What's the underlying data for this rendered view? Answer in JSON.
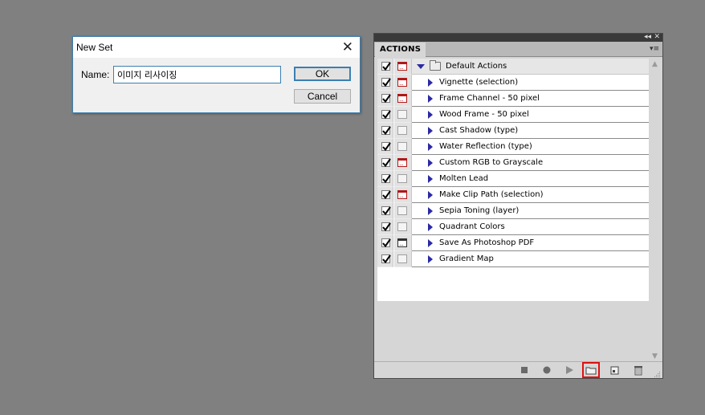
{
  "dialog": {
    "title": "New Set",
    "name_label": "Name:",
    "name_value": "이미지 리사이징",
    "ok_label": "OK",
    "cancel_label": "Cancel"
  },
  "panel": {
    "tab_label": "ACTIONS",
    "set": {
      "name": "Default Actions",
      "checked": true,
      "dialog": "red",
      "expanded": true
    },
    "actions": [
      {
        "name": "Vignette (selection)",
        "checked": true,
        "dialog": "red"
      },
      {
        "name": "Frame Channel - 50 pixel",
        "checked": true,
        "dialog": "red"
      },
      {
        "name": "Wood Frame - 50 pixel",
        "checked": true,
        "dialog": "none"
      },
      {
        "name": "Cast Shadow (type)",
        "checked": true,
        "dialog": "none"
      },
      {
        "name": "Water Reflection (type)",
        "checked": true,
        "dialog": "none"
      },
      {
        "name": "Custom RGB to Grayscale",
        "checked": true,
        "dialog": "red"
      },
      {
        "name": "Molten Lead",
        "checked": true,
        "dialog": "none"
      },
      {
        "name": "Make Clip Path (selection)",
        "checked": true,
        "dialog": "red"
      },
      {
        "name": "Sepia Toning (layer)",
        "checked": true,
        "dialog": "none"
      },
      {
        "name": "Quadrant Colors",
        "checked": true,
        "dialog": "none"
      },
      {
        "name": "Save As Photoshop PDF",
        "checked": true,
        "dialog": "black"
      },
      {
        "name": "Gradient Map",
        "checked": true,
        "dialog": "none"
      }
    ],
    "toolbar": [
      {
        "name": "stop-button",
        "icon": "stop-icon"
      },
      {
        "name": "record-button",
        "icon": "record-icon"
      },
      {
        "name": "play-button",
        "icon": "play-icon"
      },
      {
        "name": "create-new-set-button",
        "icon": "folder-icon",
        "highlighted": true
      },
      {
        "name": "create-new-action-button",
        "icon": "new-item-icon"
      },
      {
        "name": "delete-button",
        "icon": "trash-icon"
      }
    ],
    "colors": {
      "highlight": "#e01010",
      "dialog_on": "#b01818",
      "expander": "#2a2aa8"
    }
  }
}
